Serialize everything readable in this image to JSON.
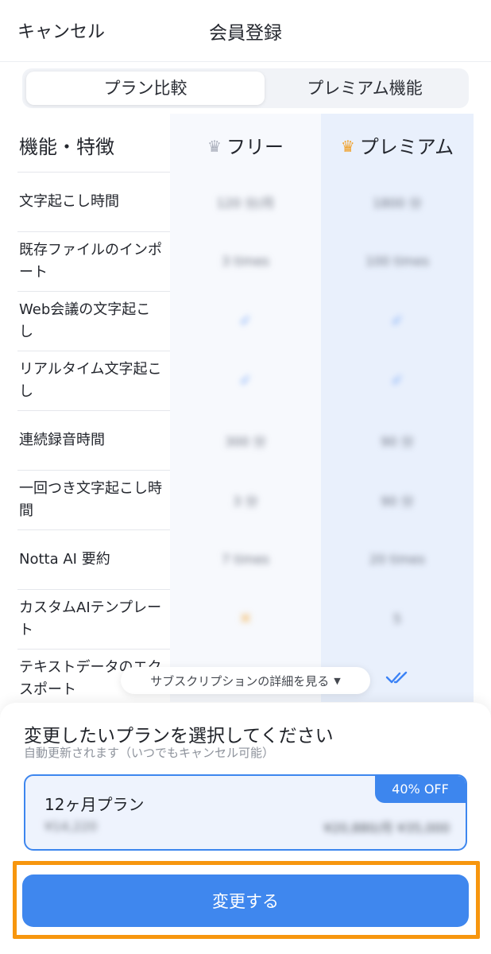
{
  "header": {
    "cancel_label": "キャンセル",
    "title": "会員登録"
  },
  "tabs": [
    {
      "label": "プラン比較",
      "active": true
    },
    {
      "label": "プレミアム機能",
      "active": false
    }
  ],
  "table": {
    "header": {
      "feature_label": "機能・特徴",
      "free_label": "フリー",
      "premium_label": "プレミアム",
      "free_icon": "crown-icon",
      "premium_icon": "crown-icon"
    },
    "rows": [
      {
        "feature": "文字起こし時間",
        "free": "120 分/月",
        "premium": "1800 分"
      },
      {
        "feature": "既存ファイルのインポート",
        "free": "3 times",
        "premium": "100 times"
      },
      {
        "feature": "Web会議の文字起こし",
        "free": "✓",
        "premium": "✓"
      },
      {
        "feature": "リアルタイム文字起こし",
        "free": "✓",
        "premium": "✓"
      },
      {
        "feature": "連続録音時間",
        "free": "300 分",
        "premium": "90 分"
      },
      {
        "feature": "一回つき文字起こし時間",
        "free": "3 分",
        "premium": "90 分"
      },
      {
        "feature": "Notta AI 要約",
        "free": "7 times",
        "premium": "20 times"
      },
      {
        "feature": "カスタムAIテンプレート",
        "free": "✕",
        "premium": "5"
      },
      {
        "feature": "テキストデータのエクスポート",
        "free": "",
        "premium": ""
      }
    ]
  },
  "details_pill": {
    "label": "サブスクリプションの詳細を見る"
  },
  "panel": {
    "title": "変更したいプランを選択してください",
    "subtitle": "自動更新されます（いつでもキャンセル可能）",
    "plan": {
      "name": "12ヶ月プラン",
      "badge": "40% OFF",
      "price_left": "¥14,220",
      "price_right": "¥20,880/月 ¥35,000"
    },
    "cta_label": "変更する"
  },
  "colors": {
    "accent": "#3f87ee",
    "highlight_frame": "#f7960e",
    "premium_column": "#e9f0fc"
  }
}
